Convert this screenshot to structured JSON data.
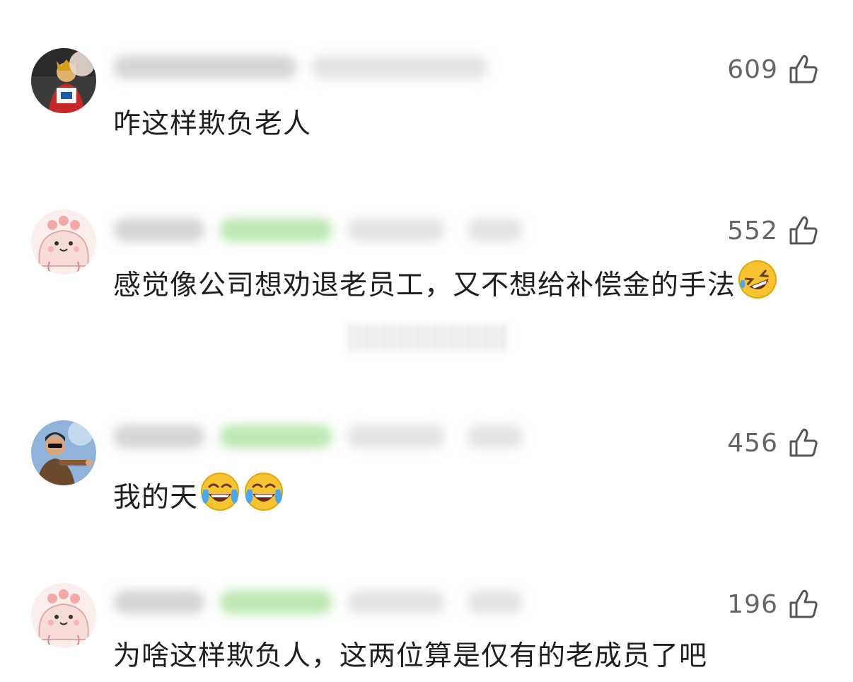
{
  "comments": [
    {
      "likes": "609",
      "text": "咋这样欺负老人",
      "emojis": [],
      "avatar_icon": "avatar-king-figure-icon"
    },
    {
      "likes": "552",
      "text": "感觉像公司想劝退老员工，又不想给补偿金的手法",
      "emojis": [
        "rofl-emoji-icon"
      ],
      "avatar_icon": "avatar-pink-blob-icon"
    },
    {
      "likes": "456",
      "text": "我的天",
      "emojis": [
        "tears-of-joy-emoji-icon",
        "tears-of-joy-emoji-icon"
      ],
      "avatar_icon": "avatar-man-sunglasses-icon"
    },
    {
      "likes": "196",
      "text": "为啥这样欺负人，这两位算是仅有的老成员了吧",
      "emojis": [],
      "avatar_icon": "avatar-pink-blob-icon"
    }
  ],
  "colors": {
    "like_text": "#666666",
    "green_badge": "#bfe8b4",
    "avatar_pink": "#f6d6d4",
    "emoji_yellow": "#f7c331"
  }
}
